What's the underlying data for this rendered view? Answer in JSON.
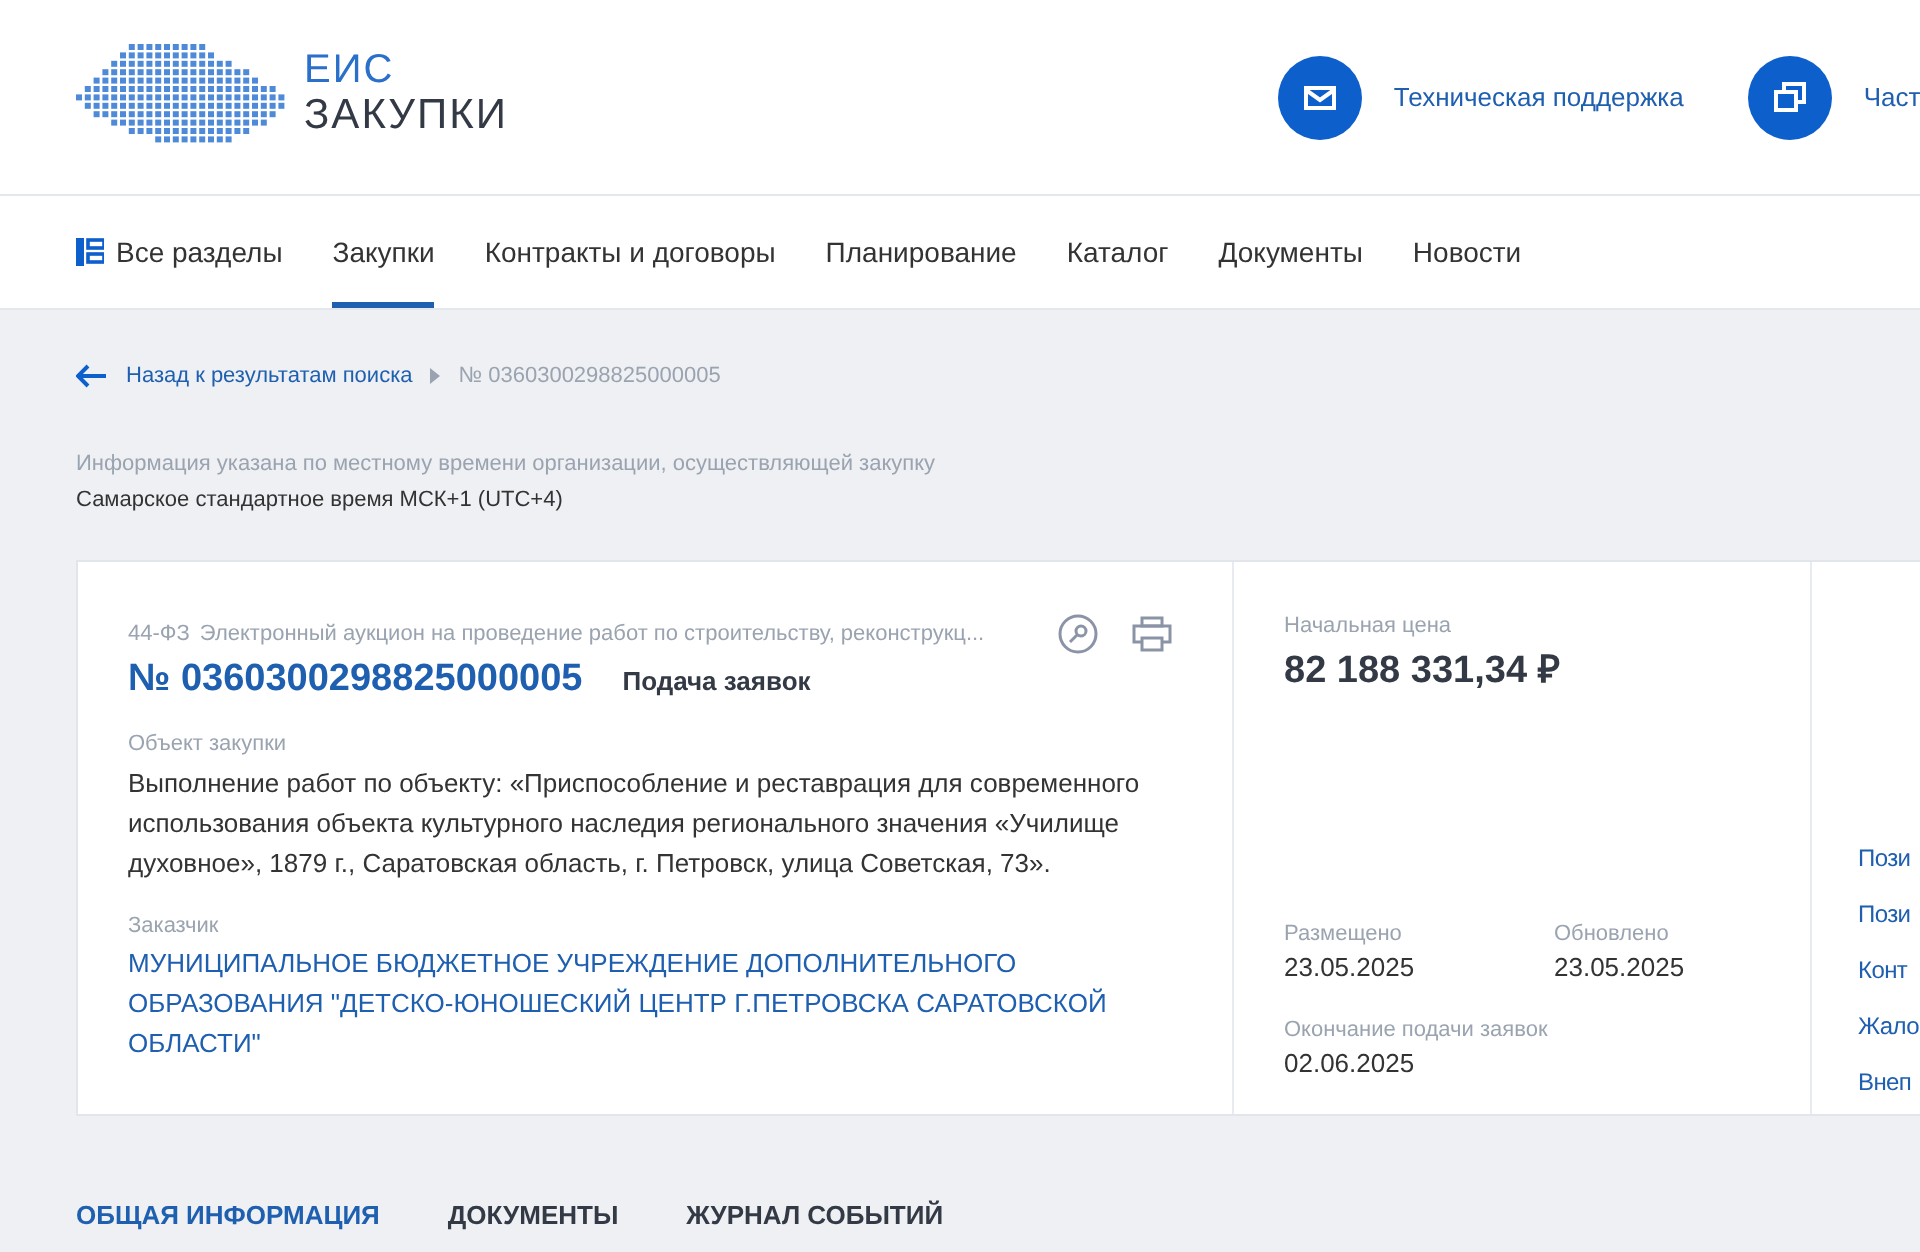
{
  "header": {
    "logo": {
      "line1": "ЕИС",
      "line2": "ЗАКУПКИ"
    },
    "links": [
      {
        "kind": "mail",
        "label": "Техническая поддержка"
      },
      {
        "kind": "chat",
        "label": "Част"
      }
    ]
  },
  "nav": {
    "items": [
      {
        "kind": "sections",
        "label": "Все разделы",
        "selected": false
      },
      {
        "kind": "plain",
        "label": "Закупки",
        "selected": true
      },
      {
        "kind": "plain",
        "label": "Контракты и договоры",
        "selected": false
      },
      {
        "kind": "plain",
        "label": "Планирование",
        "selected": false
      },
      {
        "kind": "plain",
        "label": "Каталог",
        "selected": false
      },
      {
        "kind": "plain",
        "label": "Документы",
        "selected": false
      },
      {
        "kind": "plain",
        "label": "Новости",
        "selected": false
      }
    ]
  },
  "breadcrumb": {
    "back": "Назад к результатам поиска",
    "current": "№ 0360300298825000005"
  },
  "timezone": {
    "note": "Информация указана по местному времени организации, осуществляющей закупку",
    "zone": "Самарское стандартное время МСК+1 (UTC+4)"
  },
  "card": {
    "law": "44-ФЗ",
    "type": "Электронный аукцион на проведение работ по строительству, реконструкц...",
    "number": "№ 0360300298825000005",
    "status": "Подача заявок",
    "object_label": "Объект закупки",
    "object_text": "Выполнение работ по объекту: «Приспособление и реставрация для современного использования объекта культурного наследия регионального значения «Училище духовное», 1879 г., Саратовская область, г. Петровск, улица Советская, 73».",
    "customer_label": "Заказчик",
    "customer": "МУНИЦИПАЛЬНОЕ БЮДЖЕТНОЕ УЧРЕЖДЕНИЕ ДОПОЛНИТЕЛЬНОГО ОБРАЗОВАНИЯ \"ДЕТСКО-ЮНОШЕСКИЙ ЦЕНТР Г.ПЕТРОВСКА САРАТОВСКОЙ ОБЛАСТИ\"",
    "price_label": "Начальная цена",
    "price": "82 188 331,34 ₽",
    "dates": [
      {
        "label": "Размещено",
        "value": "23.05.2025"
      },
      {
        "label": "Обновлено",
        "value": "23.05.2025"
      },
      {
        "label": "Окончание подачи заявок",
        "value": "02.06.2025"
      }
    ],
    "side_links": [
      "Пози",
      "Пози",
      "Конт",
      "Жало",
      "Внеп"
    ]
  },
  "tabs": [
    {
      "label": "ОБЩАЯ ИНФОРМАЦИЯ",
      "selected": true
    },
    {
      "label": "ДОКУМЕНТЫ",
      "selected": false
    },
    {
      "label": "ЖУРНАЛ СОБЫТИЙ",
      "selected": false
    }
  ]
}
